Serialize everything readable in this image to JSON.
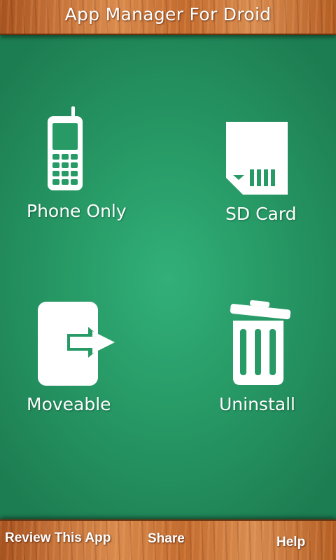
{
  "header": {
    "title": "App Manager For Droid"
  },
  "tiles": [
    {
      "label": "Phone Only",
      "icon": "mobile-phone-icon"
    },
    {
      "label": "SD Card",
      "icon": "sd-card-icon"
    },
    {
      "label": "Moveable",
      "icon": "move-arrow-icon"
    },
    {
      "label": "Uninstall",
      "icon": "trash-can-icon"
    }
  ],
  "footer": {
    "review_label": "Review This App",
    "share_label": "Share",
    "help_label": "Help"
  },
  "colors": {
    "background_green": "#279a66",
    "wood_brown": "#c8753b",
    "icon_white": "#ffffff"
  }
}
